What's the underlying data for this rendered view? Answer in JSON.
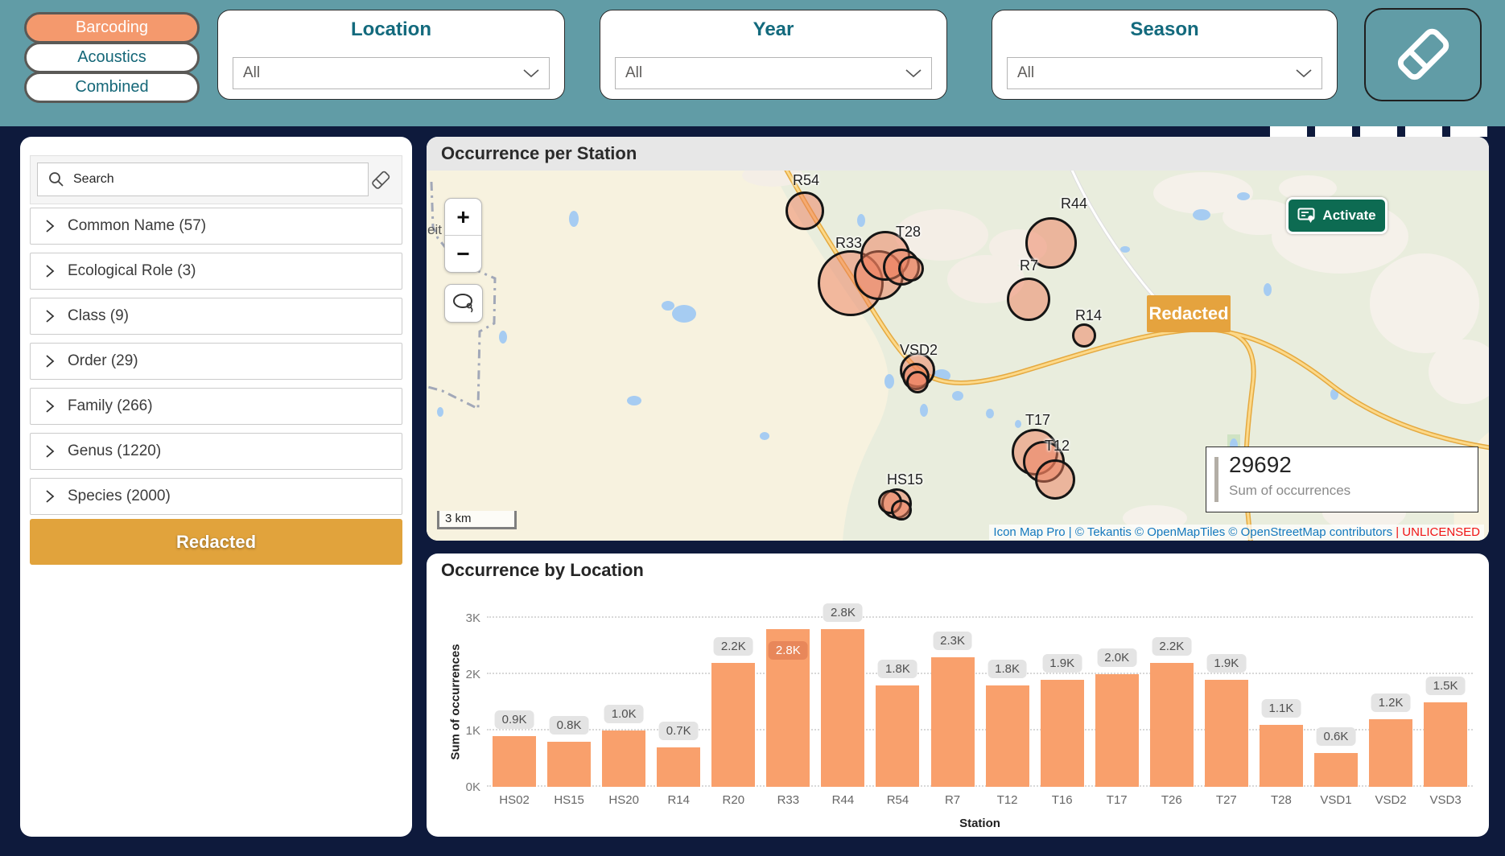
{
  "header": {
    "view_buttons": [
      {
        "label": "Barcoding",
        "selected": true
      },
      {
        "label": "Acoustics",
        "selected": false
      },
      {
        "label": "Combined",
        "selected": false
      }
    ],
    "filters": [
      {
        "title": "Location",
        "value": "All"
      },
      {
        "title": "Year",
        "value": "All"
      },
      {
        "title": "Season",
        "value": "All"
      }
    ]
  },
  "sidebar": {
    "search": {
      "placeholder": "Search"
    },
    "filters": [
      {
        "label": "Common Name (57)"
      },
      {
        "label": "Ecological Role (3)"
      },
      {
        "label": "Class (9)"
      },
      {
        "label": "Order (29)"
      },
      {
        "label": "Family (266)"
      },
      {
        "label": "Genus (1220)"
      },
      {
        "label": "Species (2000)"
      }
    ],
    "redacted_button": "Redacted"
  },
  "map_panel": {
    "title": "Occurrence per Station",
    "zoom_in": "+",
    "zoom_out": "−",
    "activate_button": "Activate",
    "redacted_label": "Redacted",
    "scale_label": "3 km",
    "partial_label": "eit",
    "summary": {
      "value": "29692",
      "label": "Sum of occurrences"
    },
    "attribution": [
      {
        "t": "Icon Map Pro",
        "s": "link"
      },
      {
        "t": " | © ",
        "s": "plain"
      },
      {
        "t": "Tekantis",
        "s": "link"
      },
      {
        "t": " © ",
        "s": "plain"
      },
      {
        "t": "OpenMapTiles",
        "s": "link"
      },
      {
        "t": " © ",
        "s": "plain"
      },
      {
        "t": "OpenStreetMap contributors",
        "s": "link"
      },
      {
        "t": " | UNLICENSED",
        "s": "red"
      }
    ],
    "stations": [
      {
        "name": "R54",
        "label": [
          455,
          2
        ],
        "circles": [
          [
            470,
            50,
            21
          ]
        ]
      },
      {
        "name": "R33",
        "label": [
          508,
          80
        ],
        "circles": [
          [
            527,
            140,
            38
          ],
          [
            562,
            130,
            28
          ]
        ]
      },
      {
        "name": "T28",
        "label": [
          583,
          66
        ],
        "circles": [
          [
            570,
            106,
            28
          ],
          [
            590,
            120,
            20
          ],
          [
            602,
            122,
            13
          ]
        ]
      },
      {
        "name": "R44",
        "label": [
          788,
          31
        ],
        "circles": [
          [
            776,
            90,
            29
          ]
        ]
      },
      {
        "name": "R7",
        "label": [
          737,
          108
        ],
        "circles": [
          [
            748,
            160,
            24
          ]
        ]
      },
      {
        "name": "R14",
        "label": [
          806,
          170
        ],
        "circles": [
          [
            817,
            205,
            12
          ]
        ]
      },
      {
        "name": "VSD2",
        "label": [
          588,
          213
        ],
        "circles": [
          [
            610,
            248,
            19
          ],
          [
            608,
            256,
            14
          ],
          [
            610,
            263,
            11
          ]
        ]
      },
      {
        "name": "T17",
        "label": [
          744,
          300
        ],
        "circles": [
          [
            756,
            350,
            26
          ]
        ]
      },
      {
        "name": "T12",
        "label": [
          768,
          332
        ],
        "circles": [
          [
            767,
            362,
            23
          ],
          [
            781,
            384,
            22
          ]
        ]
      },
      {
        "name": "HS15",
        "label": [
          572,
          374
        ],
        "circles": [
          [
            584,
            414,
            16
          ],
          [
            576,
            412,
            12
          ],
          [
            590,
            422,
            10
          ]
        ]
      }
    ]
  },
  "chart_data": {
    "type": "bar",
    "title": "Occurrence by Location",
    "xlabel": "Station",
    "ylabel": "Sum of occurrences",
    "categories": [
      "HS02",
      "HS15",
      "HS20",
      "R14",
      "R20",
      "R33",
      "R44",
      "R54",
      "R7",
      "T12",
      "T16",
      "T17",
      "T26",
      "T27",
      "T28",
      "VSD1",
      "VSD2",
      "VSD3"
    ],
    "values": [
      900,
      800,
      1000,
      700,
      2200,
      2800,
      2800,
      1800,
      2300,
      1800,
      1900,
      2000,
      2200,
      1900,
      1100,
      600,
      1200,
      1500
    ],
    "labels": [
      "0.9K",
      "0.8K",
      "1.0K",
      "0.7K",
      "2.2K",
      "2.8K",
      "2.8K",
      "1.8K",
      "2.3K",
      "1.8K",
      "1.9K",
      "2.0K",
      "2.2K",
      "1.9K",
      "1.1K",
      "0.6K",
      "1.2K",
      "1.5K"
    ],
    "highlighted_index": 5,
    "yticks": [
      "0K",
      "1K",
      "2K",
      "3K"
    ],
    "ylim": [
      0,
      3000
    ],
    "grid": "dotted-horizontal",
    "legend": "none"
  },
  "colors": {
    "header_teal": "#619CA6",
    "navy_bg": "#0E1A3C",
    "accent_orange": "#F4996D",
    "bar_orange": "#F9A06C",
    "redacted_gold": "#E1A33C",
    "teal_text": "#136A7D",
    "activate_green": "#0D6B52",
    "attribution_blue": "#1378BE",
    "unlicensed_red": "#F01414",
    "bubble_fill": "rgba(237,125,92,0.5)"
  }
}
